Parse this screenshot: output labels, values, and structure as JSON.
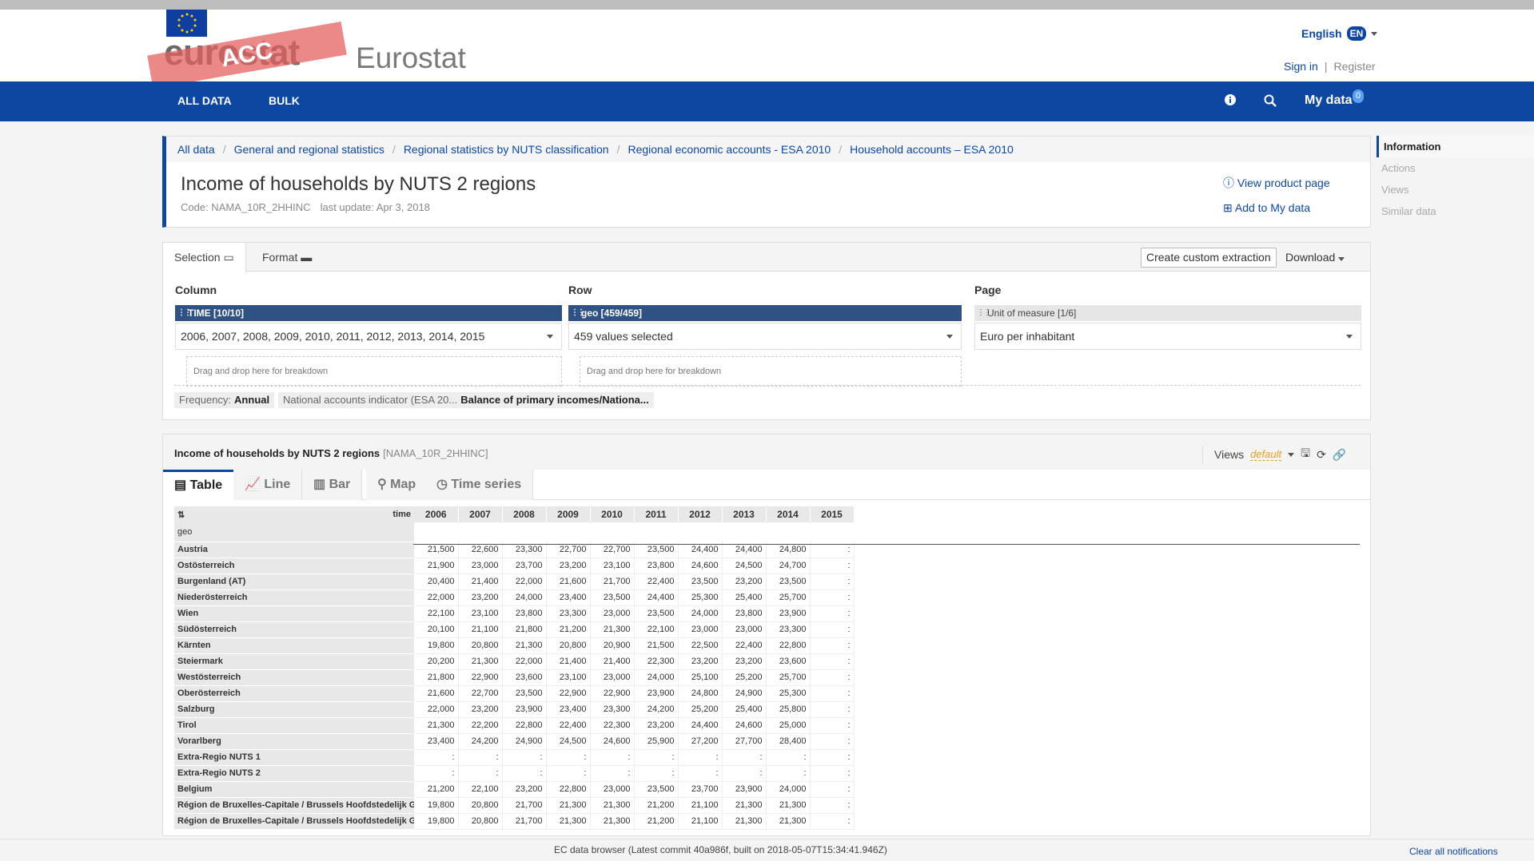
{
  "header": {
    "logo": "eurostat",
    "acc_stamp": "ACC",
    "site_name": "Eurostat",
    "language": "English",
    "lang_code": "EN",
    "sign_in": "Sign in",
    "separator": "|",
    "register": "Register"
  },
  "nav": {
    "all_data": "ALL DATA",
    "bulk": "BULK",
    "my_data": "My data",
    "my_data_count": "0"
  },
  "breadcrumb": [
    "All data",
    "General and regional statistics",
    "Regional statistics by NUTS classification",
    "Regional economic accounts - ESA 2010",
    "Household accounts – ESA 2010"
  ],
  "page": {
    "title": "Income of households by NUTS 2 regions",
    "code": "Code: NAMA_10R_2HHINC",
    "last_update": "last update: Apr 3, 2018",
    "view_product": "View product page",
    "add_to_my_data": "Add to My data"
  },
  "side_nav": [
    "Information",
    "Actions",
    "Views",
    "Similar data"
  ],
  "selection": {
    "tab_selection": "Selection",
    "tab_format": "Format",
    "create_extraction": "Create custom extraction",
    "download": "Download",
    "column_label": "Column",
    "row_label": "Row",
    "page_label": "Page",
    "column_dim": "TIME [10/10]",
    "row_dim": "geo [459/459]",
    "page_dim": "Unit of measure [1/6]",
    "column_value": "2006, 2007, 2008, 2009, 2010, 2011, 2012, 2013, 2014, 2015",
    "row_value": "459 values selected",
    "page_value": "Euro per inhabitant",
    "drop_hint": "Drag and drop here for breakdown",
    "chip1_label": "Frequency:",
    "chip1_value": "Annual",
    "chip2_label": "National accounts indicator (ESA 20...",
    "chip2_value": "Balance of primary incomes/Nationa..."
  },
  "data": {
    "title": "Income of households by NUTS 2 regions",
    "code": "[NAMA_10R_2HHINC]",
    "views_label": "Views",
    "views_default": "default",
    "tabs": [
      "Table",
      "Line",
      "Bar",
      "Map",
      "Time series"
    ],
    "time_label": "time",
    "geo_label": "geo",
    "years": [
      "2006",
      "2007",
      "2008",
      "2009",
      "2010",
      "2011",
      "2012",
      "2013",
      "2014",
      "2015"
    ],
    "rows": [
      {
        "geo": "Austria",
        "values": [
          "21,500",
          "22,600",
          "23,300",
          "22,700",
          "22,700",
          "23,500",
          "24,400",
          "24,400",
          "24,800",
          ":"
        ]
      },
      {
        "geo": "Ostösterreich",
        "values": [
          "21,900",
          "23,000",
          "23,700",
          "23,200",
          "23,100",
          "23,800",
          "24,600",
          "24,500",
          "24,700",
          ":"
        ]
      },
      {
        "geo": "Burgenland (AT)",
        "values": [
          "20,400",
          "21,400",
          "22,000",
          "21,600",
          "21,700",
          "22,400",
          "23,500",
          "23,200",
          "23,500",
          ":"
        ]
      },
      {
        "geo": "Niederösterreich",
        "values": [
          "22,000",
          "23,200",
          "24,000",
          "23,400",
          "23,500",
          "24,400",
          "25,300",
          "25,400",
          "25,700",
          ":"
        ]
      },
      {
        "geo": "Wien",
        "values": [
          "22,100",
          "23,100",
          "23,800",
          "23,300",
          "23,000",
          "23,500",
          "24,000",
          "23,800",
          "23,900",
          ":"
        ]
      },
      {
        "geo": "Südösterreich",
        "values": [
          "20,100",
          "21,100",
          "21,800",
          "21,200",
          "21,300",
          "22,100",
          "23,000",
          "23,000",
          "23,300",
          ":"
        ]
      },
      {
        "geo": "Kärnten",
        "values": [
          "19,800",
          "20,800",
          "21,300",
          "20,800",
          "20,900",
          "21,500",
          "22,500",
          "22,400",
          "22,800",
          ":"
        ]
      },
      {
        "geo": "Steiermark",
        "values": [
          "20,200",
          "21,300",
          "22,000",
          "21,400",
          "21,400",
          "22,300",
          "23,200",
          "23,200",
          "23,600",
          ":"
        ]
      },
      {
        "geo": "Westösterreich",
        "values": [
          "21,800",
          "22,900",
          "23,600",
          "23,100",
          "23,000",
          "24,000",
          "25,100",
          "25,200",
          "25,700",
          ":"
        ]
      },
      {
        "geo": "Oberösterreich",
        "values": [
          "21,600",
          "22,700",
          "23,500",
          "22,900",
          "22,900",
          "23,900",
          "24,800",
          "24,900",
          "25,300",
          ":"
        ]
      },
      {
        "geo": "Salzburg",
        "values": [
          "22,000",
          "23,200",
          "23,900",
          "23,400",
          "23,300",
          "24,200",
          "25,200",
          "25,400",
          "25,800",
          ":"
        ]
      },
      {
        "geo": "Tirol",
        "values": [
          "21,300",
          "22,200",
          "22,800",
          "22,400",
          "22,300",
          "23,200",
          "24,400",
          "24,600",
          "25,000",
          ":"
        ]
      },
      {
        "geo": "Vorarlberg",
        "values": [
          "23,400",
          "24,200",
          "24,900",
          "24,500",
          "24,600",
          "25,900",
          "27,200",
          "27,700",
          "28,400",
          ":"
        ]
      },
      {
        "geo": "Extra-Regio NUTS 1",
        "values": [
          ":",
          ":",
          ":",
          ":",
          ":",
          ":",
          ":",
          ":",
          ":",
          ":"
        ]
      },
      {
        "geo": "Extra-Regio NUTS 2",
        "values": [
          ":",
          ":",
          ":",
          ":",
          ":",
          ":",
          ":",
          ":",
          ":",
          ":"
        ]
      },
      {
        "geo": "Belgium",
        "values": [
          "21,200",
          "22,100",
          "23,200",
          "22,800",
          "23,000",
          "23,500",
          "23,700",
          "23,900",
          "24,000",
          ":"
        ]
      },
      {
        "geo": "Région de Bruxelles-Capitale / Brussels Hoofdstedelijk Ge...",
        "values": [
          "19,800",
          "20,800",
          "21,700",
          "21,300",
          "21,300",
          "21,200",
          "21,100",
          "21,300",
          "21,300",
          ":"
        ]
      },
      {
        "geo": "Région de Bruxelles-Capitale / Brussels Hoofdstedelijk Ge...",
        "values": [
          "19,800",
          "20,800",
          "21,700",
          "21,300",
          "21,300",
          "21,200",
          "21,100",
          "21,300",
          "21,300",
          ":"
        ]
      }
    ]
  },
  "footer": {
    "build": "EC data browser (Latest commit 40a986f, built on 2018-05-07T15:34:41.946Z)",
    "clear": "Clear all notifications"
  }
}
